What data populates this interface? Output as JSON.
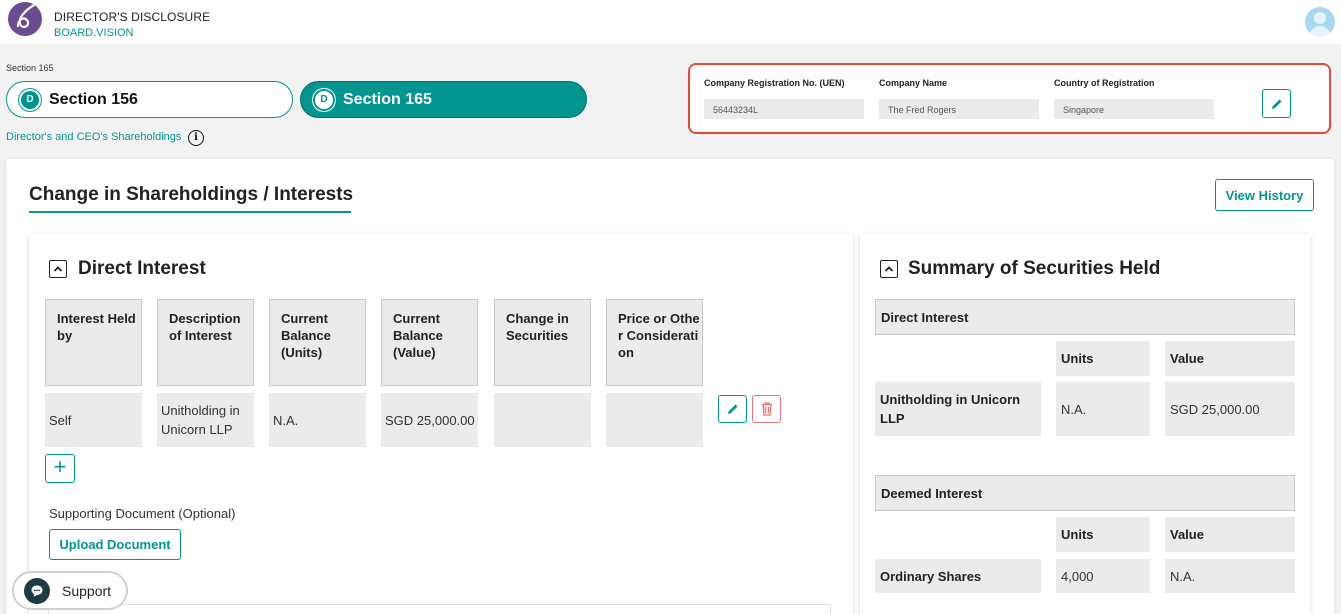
{
  "header": {
    "title": "DIRECTOR'S DISCLOSURE",
    "subtitle": "BOARD.VISION"
  },
  "sections": {
    "caption": "Section 165",
    "items": [
      {
        "badge": "D",
        "label": "Section 156",
        "selected": false
      },
      {
        "badge": "D",
        "label": "Section 165",
        "selected": true
      }
    ],
    "link": "Director's and CEO's Shareholdings",
    "info_glyph": "i"
  },
  "company": {
    "uen_label": "Company Registration No. (UEN)",
    "uen_value": "56443234L",
    "name_label": "Company Name",
    "name_value": "The Fred Rogers",
    "country_label": "Country of Registration",
    "country_value": "Singapore"
  },
  "main": {
    "title": "Change in Shareholdings / Interests",
    "view_history": "View History"
  },
  "direct": {
    "title": "Direct Interest",
    "columns": [
      "Interest Held by",
      "Description of Interest",
      "Current Balance (Units)",
      "Current Balance (Value)",
      "Change in Securities",
      "Price or Other Consideration"
    ],
    "row": [
      "Self",
      "Unitholding in Unicorn LLP",
      "N.A.",
      "SGD 25,000.00",
      "",
      ""
    ],
    "add_glyph": "+",
    "supporting_doc": "Supporting Document (Optional)",
    "upload": "Upload Document"
  },
  "summary": {
    "title": "Summary of Securities Held",
    "direct_heading": "Direct Interest",
    "direct_units_label": "Units",
    "direct_value_label": "Value",
    "direct_row": {
      "name": "Unitholding in Unicorn LLP",
      "units": "N.A.",
      "value": "SGD 25,000.00"
    },
    "deemed_heading": "Deemed Interest",
    "deemed_units_label": "Units",
    "deemed_value_label": "Value",
    "deemed_row": {
      "name": "Ordinary Shares",
      "units": "4,000",
      "value": "N.A."
    }
  },
  "support": {
    "label": "Support"
  },
  "colors": {
    "accent": "#00968f",
    "highlight_border": "#e24a3b",
    "delete": "#e57373",
    "brand_logo": "#6a4c93"
  }
}
